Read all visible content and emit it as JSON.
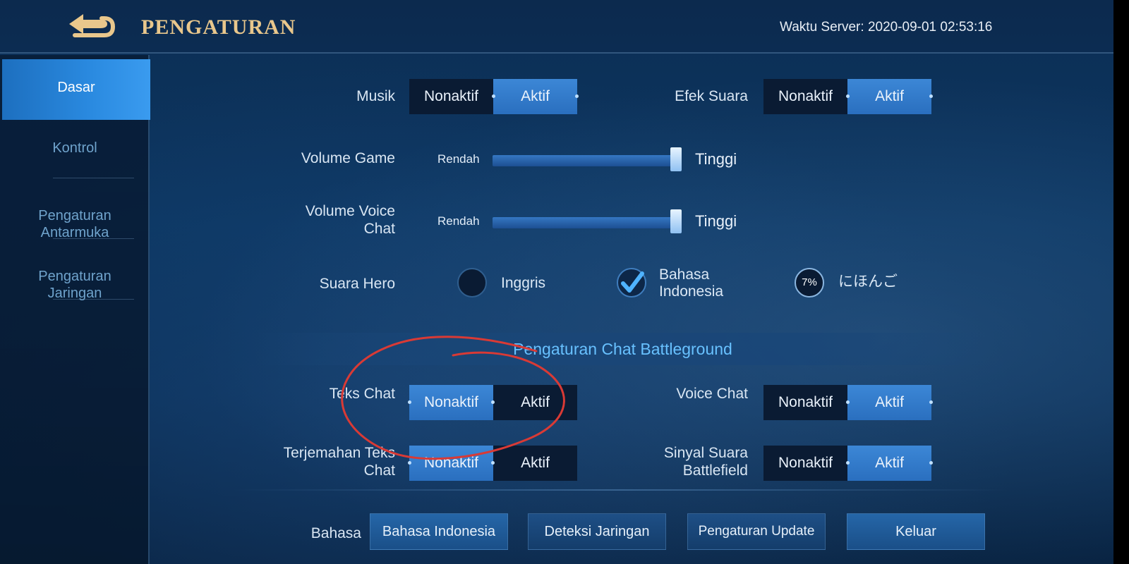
{
  "header": {
    "title": "PENGATURAN",
    "server_time": "Waktu Server: 2020-09-01 02:53:16",
    "back_icon": "back-arrow-icon"
  },
  "sidebar": {
    "items": [
      {
        "label": "Dasar",
        "active": true
      },
      {
        "label": "Kontrol",
        "active": false
      },
      {
        "label": "Pengaturan\nAntarmuka",
        "active": false
      },
      {
        "label": "Pengaturan\nJaringan",
        "active": false
      }
    ]
  },
  "settings": {
    "musik": {
      "label": "Musik",
      "off": "Nonaktif",
      "on": "Aktif",
      "selected": "on"
    },
    "efek_suara": {
      "label": "Efek Suara",
      "off": "Nonaktif",
      "on": "Aktif",
      "selected": "on"
    },
    "volume_game": {
      "label": "Volume Game",
      "low": "Rendah",
      "high": "Tinggi",
      "value": 1.0
    },
    "volume_voice": {
      "label": "Volume Voice\nChat",
      "low": "Rendah",
      "high": "Tinggi",
      "value": 1.0
    },
    "suara_hero": {
      "label": "Suara Hero",
      "options": [
        {
          "label": "Inggris",
          "checked": false
        },
        {
          "label": "Bahasa\nIndonesia",
          "checked": true
        },
        {
          "label": "にほんご",
          "checked": false,
          "download_progress": "7%"
        }
      ]
    }
  },
  "chat": {
    "section_title": "Pengaturan Chat Battleground",
    "teks_chat": {
      "label": "Teks Chat",
      "off": "Nonaktif",
      "on": "Aktif",
      "selected": "off"
    },
    "voice_chat": {
      "label": "Voice Chat",
      "off": "Nonaktif",
      "on": "Aktif",
      "selected": "on"
    },
    "terjemahan": {
      "label": "Terjemahan Teks\nChat",
      "off": "Nonaktif",
      "on": "Aktif",
      "selected": "off"
    },
    "sinyal_suara": {
      "label": "Sinyal Suara\nBattlefield",
      "off": "Nonaktif",
      "on": "Aktif",
      "selected": "on"
    }
  },
  "footer": {
    "bahasa_label": "Bahasa",
    "bahasa_value": "Bahasa Indonesia",
    "deteksi": "Deteksi Jaringan",
    "update": "Pengaturan Update",
    "keluar": "Keluar"
  },
  "colors": {
    "accent_selected": "#2f78c8",
    "title_gold": "#e9c78c",
    "section_title": "#68c1ff",
    "annotation_red": "#d93a35"
  }
}
